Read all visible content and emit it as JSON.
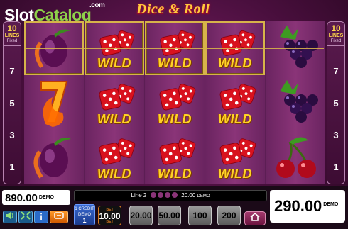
{
  "watermark": {
    "part1": "Slot",
    "part2": "Catalog",
    "suffix": ".com"
  },
  "game_logo": "Dice & Roll",
  "left_panel": {
    "lines": "10",
    "lines_label": "LINES",
    "fixed_label": "Fixed",
    "numbers": [
      "7",
      "5",
      "3",
      "1"
    ]
  },
  "right_panel": {
    "lines": "10",
    "lines_label": "LINES",
    "fixed_label": "Fixed",
    "numbers": [
      "7",
      "5",
      "3",
      "1"
    ]
  },
  "reels": [
    [
      "plum",
      "seven",
      "plum"
    ],
    [
      "wild",
      "wild",
      "wild"
    ],
    [
      "wild",
      "wild",
      "wild"
    ],
    [
      "wild",
      "wild",
      "wild"
    ],
    [
      "grapes",
      "grapes",
      "cherries"
    ]
  ],
  "wild_label": "WILD",
  "balance": {
    "value": "890.00",
    "unit": "DEMO"
  },
  "info_bar": {
    "line_text": "Line  2",
    "amount": "20.00",
    "unit": "DEMO"
  },
  "win": {
    "value": "290.00",
    "unit": "DEMO"
  },
  "credit": {
    "label1": "1 CREDIT",
    "label2": "DEMO",
    "value": "1"
  },
  "bets": {
    "selected": "10.00",
    "selected_tag_top": "BET",
    "selected_tag_bottom": "BET",
    "options": [
      "20.00",
      "50.00",
      "100",
      "200"
    ]
  },
  "icons": [
    "sound-icon",
    "fullscreen-icon",
    "info-icon",
    "gamble-icon",
    "home-icon"
  ],
  "colors": {
    "background": "#4a0f3e",
    "accent_gold": "#ffd227",
    "dice_red": "#d8121e"
  }
}
